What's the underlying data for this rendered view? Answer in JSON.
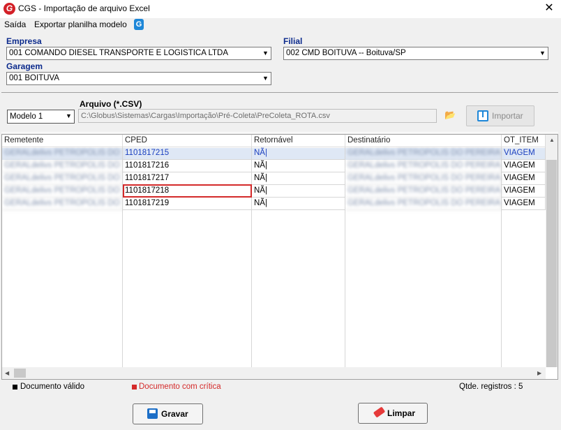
{
  "window": {
    "title": "CGS - Importação de arquivo Excel",
    "app_icon": "G",
    "close_glyph": "✕"
  },
  "menu": {
    "items": [
      "Saída",
      "Exportar planilha modelo"
    ],
    "icon_glyph": "G"
  },
  "form": {
    "empresa_label": "Empresa",
    "empresa_value": "001 COMANDO DIESEL TRANSPORTE E LOGISTICA LTDA",
    "filial_label": "Filial",
    "filial_value": "002 CMD BOITUVA -- Boituva/SP",
    "garagem_label": "Garagem",
    "garagem_value": "001 BOITUVA",
    "arquivo_label": "Arquivo (*.CSV)",
    "modelo_value": "Modelo 1",
    "arquivo_value": "C:\\Globus\\Sistemas\\Cargas\\Importação\\Pré-Coleta\\PreColeta_ROTA.csv",
    "importar_label": "Importar",
    "combo_arrow": "▼",
    "folder_glyph": "📂"
  },
  "grid": {
    "columns": [
      "Remetente",
      "CPED",
      "Retornável",
      "Destinatário",
      "OT_ITEM"
    ],
    "rows": [
      {
        "remetente": "GERALdelivs PETROPOLIS DO",
        "cped": "1101817215",
        "retornavel": "NÃ|",
        "destinatario": "GERALdelivs PETROPOLIS DO PEREIRA",
        "ot_item": "VIAGEM"
      },
      {
        "remetente": "GERALdelivs PETROPOLIS DO",
        "cped": "1101817216",
        "retornavel": "NÃ|",
        "destinatario": "GERALdelivs PETROPOLIS DO PEREIRA",
        "ot_item": "VIAGEM"
      },
      {
        "remetente": "GERALdelivs PETROPOLIS DO",
        "cped": "1101817217",
        "retornavel": "NÃ|",
        "destinatario": "GERALdelivs PETROPOLIS DO PEREIRA",
        "ot_item": "VIAGEM"
      },
      {
        "remetente": "GERALdelivs PETROPOLIS DO",
        "cped": "1101817218",
        "retornavel": "NÃ|",
        "destinatario": "GERALdelivs PETROPOLIS DO PEREIRA",
        "ot_item": "VIAGEM"
      },
      {
        "remetente": "GERALdelivs PETROPOLIS DO",
        "cped": "1101817219",
        "retornavel": "NÃ|",
        "destinatario": "GERALdelivs PETROPOLIS DO PEREIRA",
        "ot_item": "VIAGEM"
      }
    ]
  },
  "status": {
    "valid_label": "Documento válido",
    "critica_label": "Documento com crítica",
    "count_label": "Qtde. registros : 5",
    "valid_color": "#000000",
    "critica_color": "#d42a2a"
  },
  "buttons": {
    "gravar": "Gravar",
    "limpar": "Limpar"
  }
}
